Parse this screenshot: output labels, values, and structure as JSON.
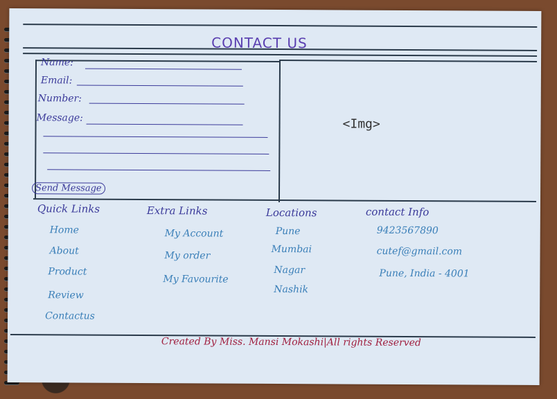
{
  "title": "CONTACT US",
  "form": {
    "name_label": "Name:",
    "email_label": "Email:",
    "number_label": "Number:",
    "message_label": "Message:",
    "send_button": "Send Message"
  },
  "image_placeholder": "<Img>",
  "footer_columns": {
    "quick_links": {
      "heading": "Quick Links",
      "items": [
        "Home",
        "About",
        "Product",
        "Review",
        "Contactus"
      ]
    },
    "extra_links": {
      "heading": "Extra Links",
      "items": [
        "My Account",
        "My order",
        "My Favourite"
      ]
    },
    "locations": {
      "heading": "Locations",
      "items": [
        "Pune",
        "Mumbai",
        "Nagar",
        "Nashik"
      ]
    },
    "contact_info": {
      "heading": "contact Info",
      "items": [
        "9423567890",
        "cutef@gmail.com",
        "Pune, India - 4001"
      ]
    }
  },
  "credit": "Created By Miss. Mansi Mokashi|All rights Reserved",
  "colors": {
    "ink_purple": "#3b3a9a",
    "ink_blue": "#3a7fb8",
    "ink_red": "#a02040",
    "paper": "#dfe9f4"
  }
}
